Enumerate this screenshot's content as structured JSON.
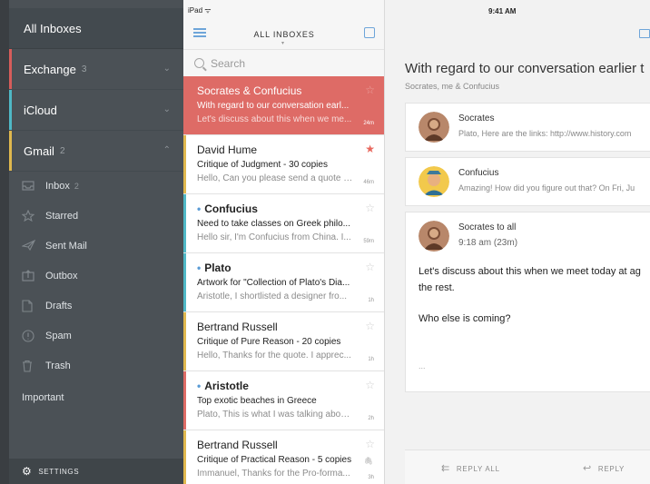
{
  "sidebar": {
    "all_inboxes": "All Inboxes",
    "accounts": [
      {
        "name": "Exchange",
        "count": "3",
        "accent": "#d75d5b",
        "chevron": "⌄"
      },
      {
        "name": "iCloud",
        "count": "",
        "accent": "#4fb8c6",
        "chevron": "⌄"
      },
      {
        "name": "Gmail",
        "count": "2",
        "accent": "#e0b84e",
        "chevron": "⌃"
      }
    ],
    "folders": [
      {
        "label": "Inbox",
        "count": "2",
        "icon": "inbox-icon"
      },
      {
        "label": "Starred",
        "count": "",
        "icon": "star-icon"
      },
      {
        "label": "Sent Mail",
        "count": "",
        "icon": "paper-plane-icon"
      },
      {
        "label": "Outbox",
        "count": "",
        "icon": "outbox-icon"
      },
      {
        "label": "Drafts",
        "count": "",
        "icon": "draft-icon"
      },
      {
        "label": "Spam",
        "count": "",
        "icon": "spam-icon"
      },
      {
        "label": "Trash",
        "count": "",
        "icon": "trash-icon"
      },
      {
        "label": "Important",
        "count": "",
        "icon": ""
      }
    ],
    "settings": "SETTINGS"
  },
  "status": {
    "device": "iPad ᯤ",
    "time": "9:41 AM"
  },
  "list": {
    "title": "ALL INBOXES",
    "search_placeholder": "Search",
    "messages": [
      {
        "from": "Socrates & Confucius",
        "subject": "With regard to our conversation earl...",
        "preview": "Let's discuss about this when we me...",
        "time": "24m",
        "unread": false,
        "starred": false,
        "attachment": false,
        "accent": "#de6b66"
      },
      {
        "from": "David Hume",
        "subject": "Critique of Judgment - 30 copies",
        "preview": "Hello, Can you please send a quote f...",
        "time": "46m",
        "unread": false,
        "starred": true,
        "attachment": false,
        "accent": "#e0b84e"
      },
      {
        "from": "Confucius",
        "subject": "Need to take classes on Greek philo...",
        "preview": "Hello sir, I'm Confucius from China. I...",
        "time": "59m",
        "unread": true,
        "starred": false,
        "attachment": false,
        "accent": "#4fb8c6"
      },
      {
        "from": "Plato",
        "subject": "Artwork for \"Collection of Plato's Dia...",
        "preview": "Aristotle, I shortlisted a designer fro...",
        "time": "1h",
        "unread": true,
        "starred": false,
        "attachment": false,
        "accent": "#4fb8c6"
      },
      {
        "from": "Bertrand Russell",
        "subject": "Critique of Pure Reason - 20 copies",
        "preview": "Hello, Thanks for the quote. I apprec...",
        "time": "1h",
        "unread": false,
        "starred": false,
        "attachment": false,
        "accent": "#e0b84e"
      },
      {
        "from": "Aristotle",
        "subject": "Top exotic beaches in Greece",
        "preview": "Plato, This is what I was talking abou...",
        "time": "2h",
        "unread": true,
        "starred": false,
        "attachment": false,
        "accent": "#de6b66"
      },
      {
        "from": "Bertrand Russell",
        "subject": "Critique of Practical Reason - 5 copies",
        "preview": "Immanuel, Thanks for the Pro-forma...",
        "time": "3h",
        "unread": false,
        "starred": false,
        "attachment": true,
        "accent": "#e0b84e"
      }
    ]
  },
  "thread": {
    "subject": "With regard to our conversation earlier t",
    "participants": "Socrates, me & Confucius",
    "messages": [
      {
        "sender": "Socrates",
        "snippet": "Plato, Here are the links: http://www.history.com"
      },
      {
        "sender": "Confucius",
        "snippet": "Amazing! How did you figure out that? On Fri, Ju"
      },
      {
        "sender": "Socrates to all",
        "snippet": "9:18 am (23m)"
      }
    ],
    "body": [
      "Let's discuss about this when we meet today at ag",
      "the rest.",
      "Who else is coming?"
    ],
    "trimmed": "...",
    "reply_all": "REPLY ALL",
    "reply": "REPLY"
  }
}
